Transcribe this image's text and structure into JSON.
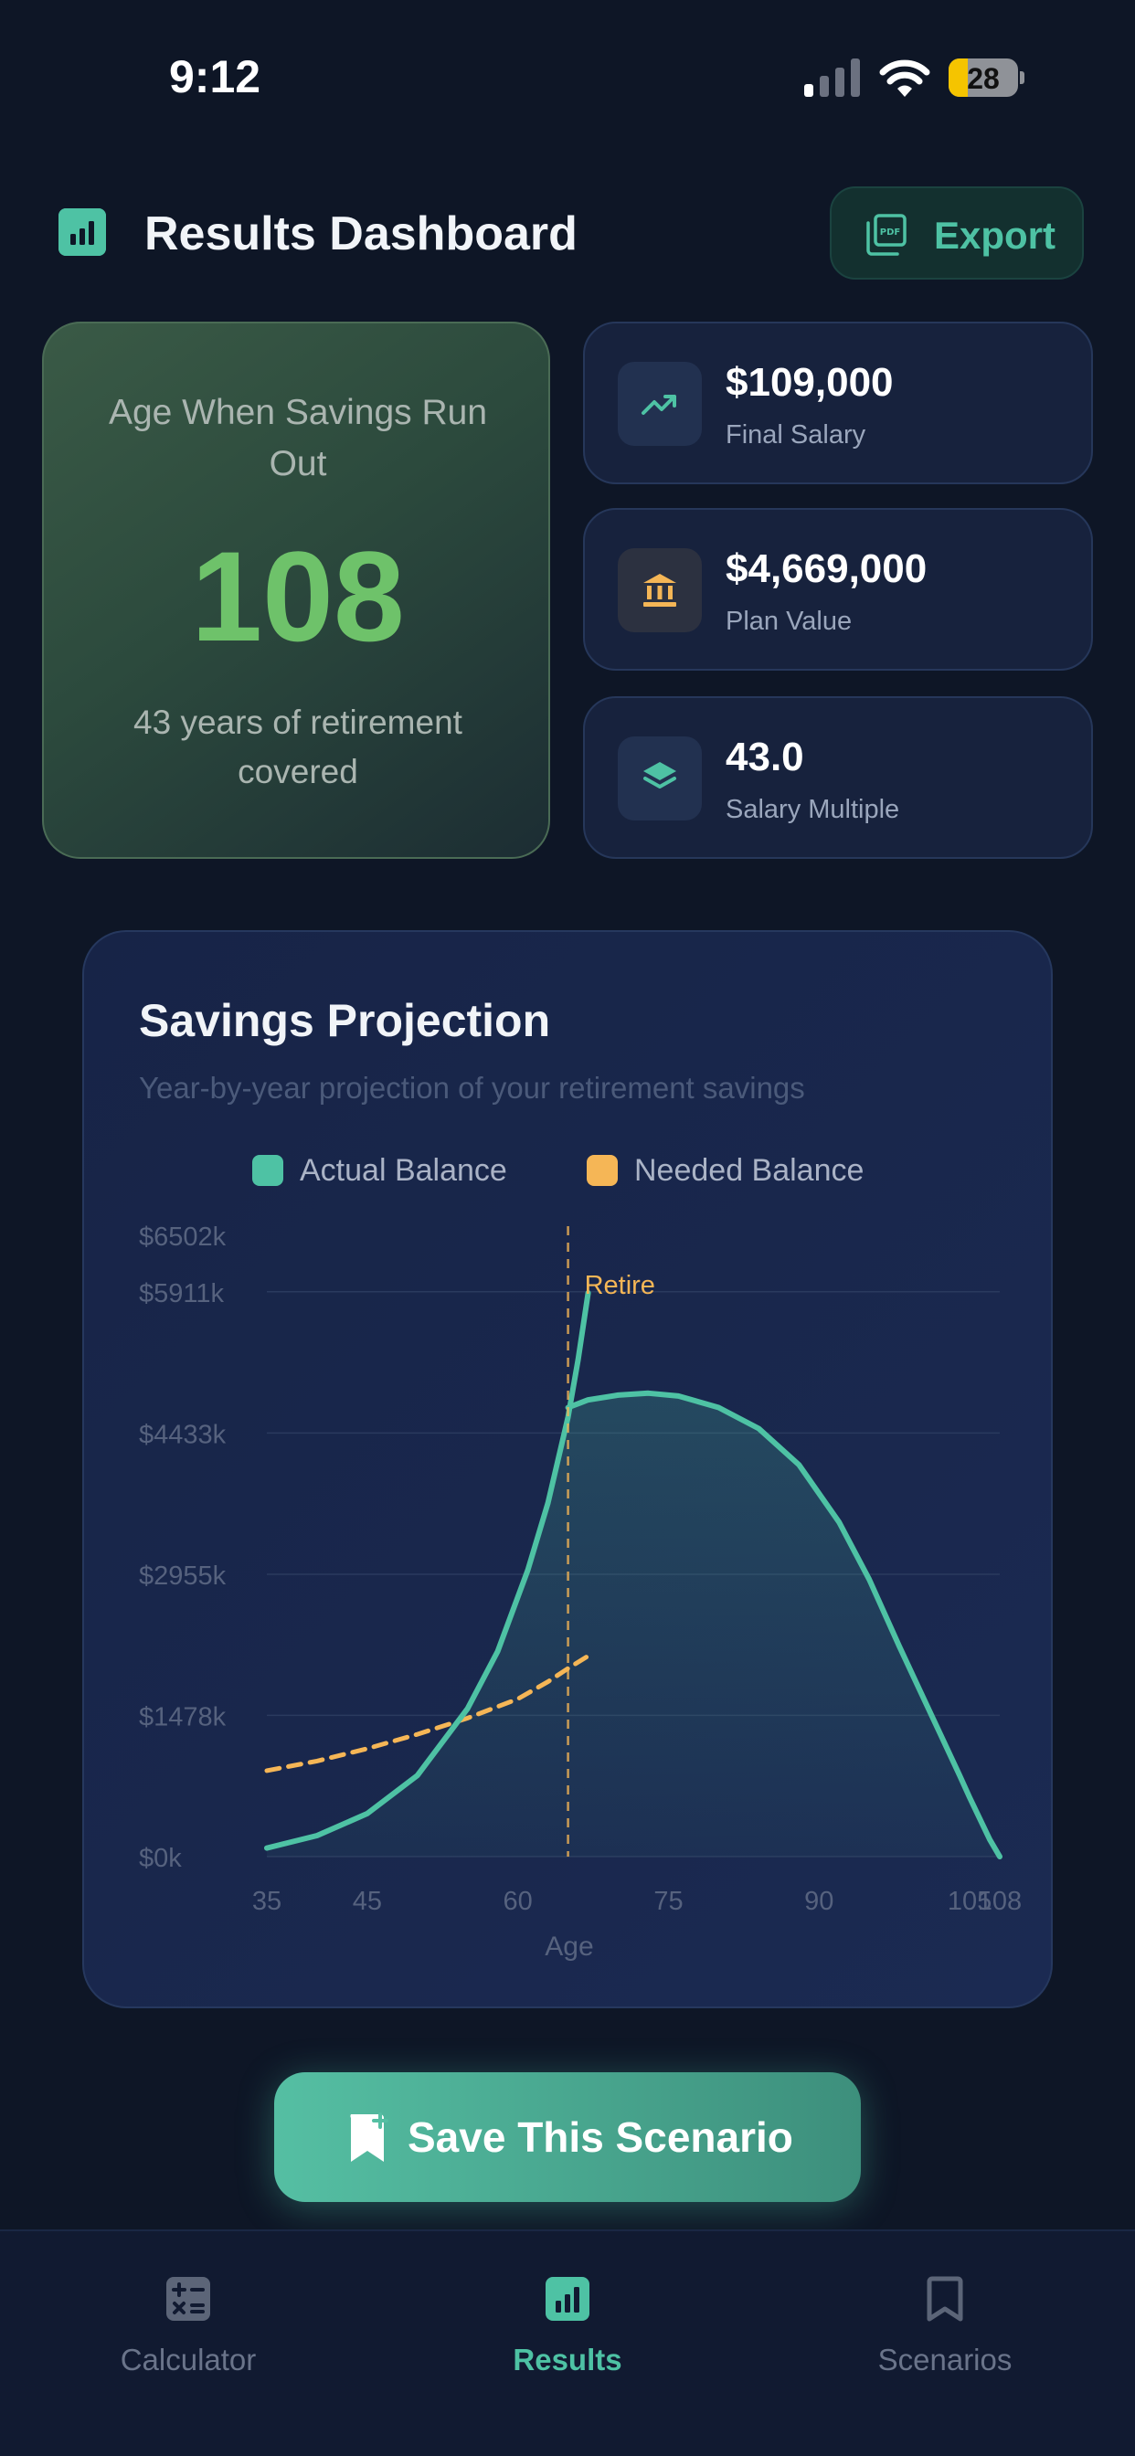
{
  "status_bar": {
    "time": "9:12",
    "battery": "28",
    "battery_level": 0.28
  },
  "header": {
    "title": "Results Dashboard",
    "export_label": "Export"
  },
  "age_card": {
    "label": "Age When Savings Run Out",
    "value": "108",
    "subtitle": "43 years of retirement covered"
  },
  "stats": [
    {
      "value": "$109,000",
      "label": "Final Salary",
      "icon": "trending-up-icon",
      "color": "#4ec2a4"
    },
    {
      "value": "$4,669,000",
      "label": "Plan Value",
      "icon": "bank-icon",
      "color": "#f5b656"
    },
    {
      "value": "43.0",
      "label": "Salary Multiple",
      "icon": "layers-icon",
      "color": "#4ec2a4"
    }
  ],
  "chart": {
    "title": "Savings Projection",
    "subtitle": "Year-by-year projection of your retirement savings",
    "colors": {
      "actual": "#4ec2a4",
      "needed": "#f5b656"
    }
  },
  "chart_data": {
    "type": "area",
    "x_label": "Age",
    "xlim": [
      35,
      108
    ],
    "ylim": [
      0,
      6502
    ],
    "x_ticks": [
      35,
      45,
      60,
      75,
      90,
      105,
      108
    ],
    "x_tick_labels": [
      "35",
      "45",
      "60",
      "75",
      "90",
      "105",
      "108"
    ],
    "y_ticks": [
      0,
      1478,
      2955,
      4433,
      5911,
      6502
    ],
    "y_tick_labels": [
      "$0k",
      "$1478k",
      "$2955k",
      "$4433k",
      "$5911k",
      "$6502k"
    ],
    "retire_age": 65,
    "retire_label": "Retire",
    "series": [
      {
        "name": "Actual Balance",
        "x": [
          35,
          40,
          45,
          50,
          55,
          58,
          61,
          63,
          65,
          66,
          67
        ],
        "values": [
          90,
          220,
          450,
          850,
          1550,
          2150,
          3000,
          3700,
          4600,
          5200,
          5900
        ]
      },
      {
        "name": "Actual Balance",
        "x": [
          65,
          67,
          70,
          73,
          76,
          80,
          84,
          88,
          92,
          95,
          98,
          100,
          102,
          104,
          105,
          106,
          107,
          108
        ],
        "values": [
          4700,
          4780,
          4830,
          4850,
          4820,
          4700,
          4480,
          4100,
          3500,
          2900,
          2200,
          1750,
          1300,
          850,
          620,
          400,
          180,
          0
        ]
      },
      {
        "name": "Needed Balance",
        "x": [
          35,
          40,
          45,
          50,
          55,
          60,
          63,
          65,
          67
        ],
        "values": [
          900,
          1000,
          1130,
          1280,
          1450,
          1650,
          1830,
          1970,
          2100
        ]
      }
    ]
  },
  "save_button": {
    "label": "Save This Scenario"
  },
  "tabs": [
    {
      "label": "Calculator",
      "icon": "calculator-icon"
    },
    {
      "label": "Results",
      "icon": "results-icon"
    },
    {
      "label": "Scenarios",
      "icon": "bookmark-icon"
    }
  ]
}
